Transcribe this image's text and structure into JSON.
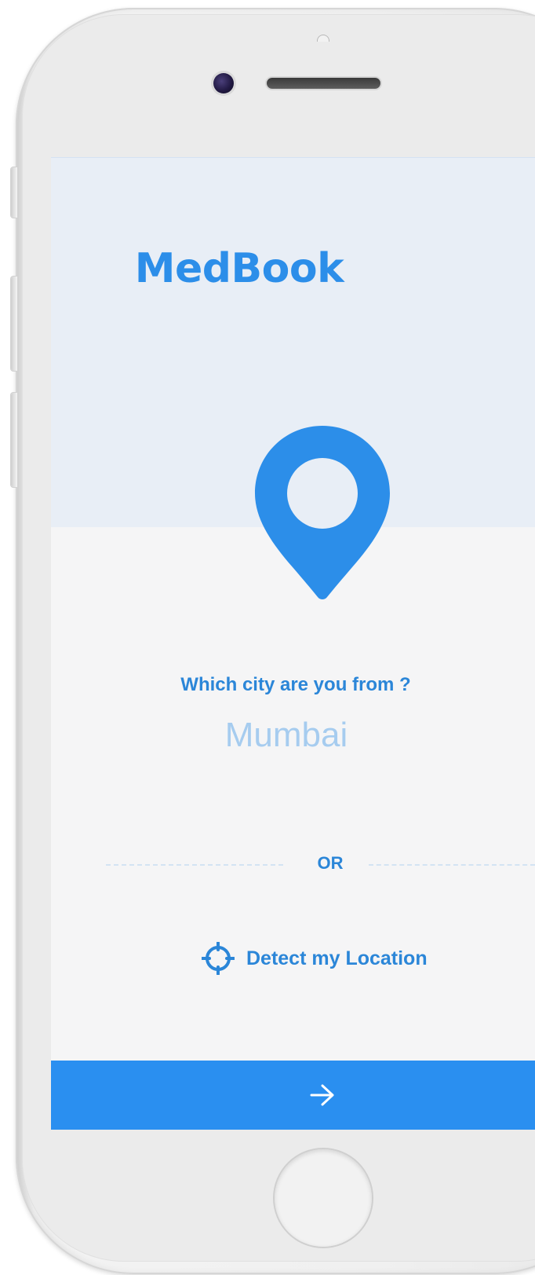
{
  "app": {
    "title": "MedBook"
  },
  "location": {
    "question": "Which city are you from ?",
    "city_value": "Mumbai",
    "or_label": "OR",
    "detect_label": "Detect my Location"
  },
  "icons": {
    "pin": "map-pin-icon",
    "detect": "crosshair-icon",
    "next": "arrow-right-icon"
  },
  "colors": {
    "accent": "#2a8ff0",
    "header_bg": "#e8eef6",
    "screen_bg": "#f5f5f6",
    "city_text": "#a6ccef"
  }
}
